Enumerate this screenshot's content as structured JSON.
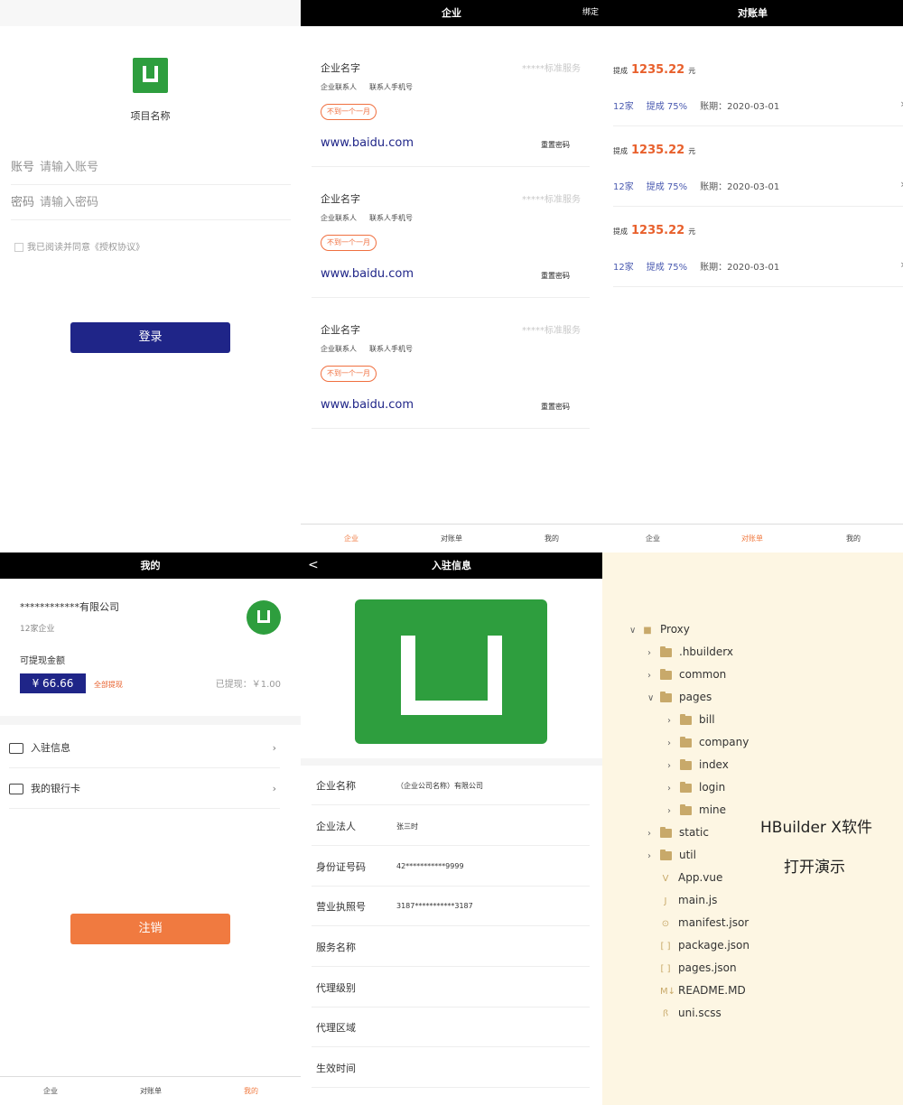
{
  "login": {
    "title": "",
    "project_name": "项目名称",
    "account_label": "账号",
    "account_placeholder": "请输入账号",
    "password_label": "密码",
    "password_placeholder": "请输入密码",
    "agree_text": "我已阅读并同意《授权协议》",
    "login_button": "登录"
  },
  "company": {
    "nav_title": "企业",
    "nav_right": "绑定",
    "cards": [
      {
        "name": "企业名字",
        "service": "*****标准服务",
        "contact": "企业联系人",
        "phone": "联系人手机号",
        "tag": "不到一个一月",
        "url": "www.baidu.com",
        "reset": "重置密码"
      },
      {
        "name": "企业名字",
        "service": "*****标准服务",
        "contact": "企业联系人",
        "phone": "联系人手机号",
        "tag": "不到一个一月",
        "url": "www.baidu.com",
        "reset": "重置密码"
      },
      {
        "name": "企业名字",
        "service": "*****标准服务",
        "contact": "企业联系人",
        "phone": "联系人手机号",
        "tag": "不到一个一月",
        "url": "www.baidu.com",
        "reset": "重置密码"
      }
    ]
  },
  "bill": {
    "nav_title": "对账单",
    "items": [
      {
        "label": "提成",
        "amount": "1235.22",
        "unit": "元",
        "count": "12家",
        "rate": "提成 75%",
        "period": "账期：2020-03-01"
      },
      {
        "label": "提成",
        "amount": "1235.22",
        "unit": "元",
        "count": "12家",
        "rate": "提成 75%",
        "period": "账期：2020-03-01"
      },
      {
        "label": "提成",
        "amount": "1235.22",
        "unit": "元",
        "count": "12家",
        "rate": "提成 75%",
        "period": "账期：2020-03-01"
      }
    ]
  },
  "tabs": [
    "企业",
    "对账单",
    "我的"
  ],
  "mine": {
    "nav_title": "我的",
    "company": "************有限公司",
    "sub": "12家企业",
    "withdraw_label": "可提现金额",
    "amount": "¥ 66.66",
    "withdraw_all": "全部提现",
    "withdrawn": "已提现：￥1.00",
    "menu": [
      "入驻信息",
      "我的银行卡"
    ],
    "logout_button": "注销"
  },
  "info": {
    "nav_title": "入驻信息",
    "back": "<",
    "rows": [
      {
        "label": "企业名称",
        "value": "（企业公司名称）有限公司"
      },
      {
        "label": "企业法人",
        "value": "张三时"
      },
      {
        "label": "身份证号码",
        "value": "42***********9999"
      },
      {
        "label": "营业执照号",
        "value": "3187***********3187"
      },
      {
        "label": "服务名称",
        "value": ""
      },
      {
        "label": "代理级别",
        "value": ""
      },
      {
        "label": "代理区域",
        "value": ""
      },
      {
        "label": "生效时间",
        "value": ""
      }
    ]
  },
  "tree": {
    "root": "Proxy",
    "items": [
      ".hbuilderx",
      "common",
      "pages",
      "bill",
      "company",
      "index",
      "login",
      "mine",
      "static",
      "util",
      "App.vue",
      "main.js",
      "manifest.jsor",
      "package.json",
      "pages.json",
      "README.MD",
      "uni.scss"
    ],
    "caption_line1": "HBuilder X软件",
    "caption_line2": "打开演示"
  }
}
